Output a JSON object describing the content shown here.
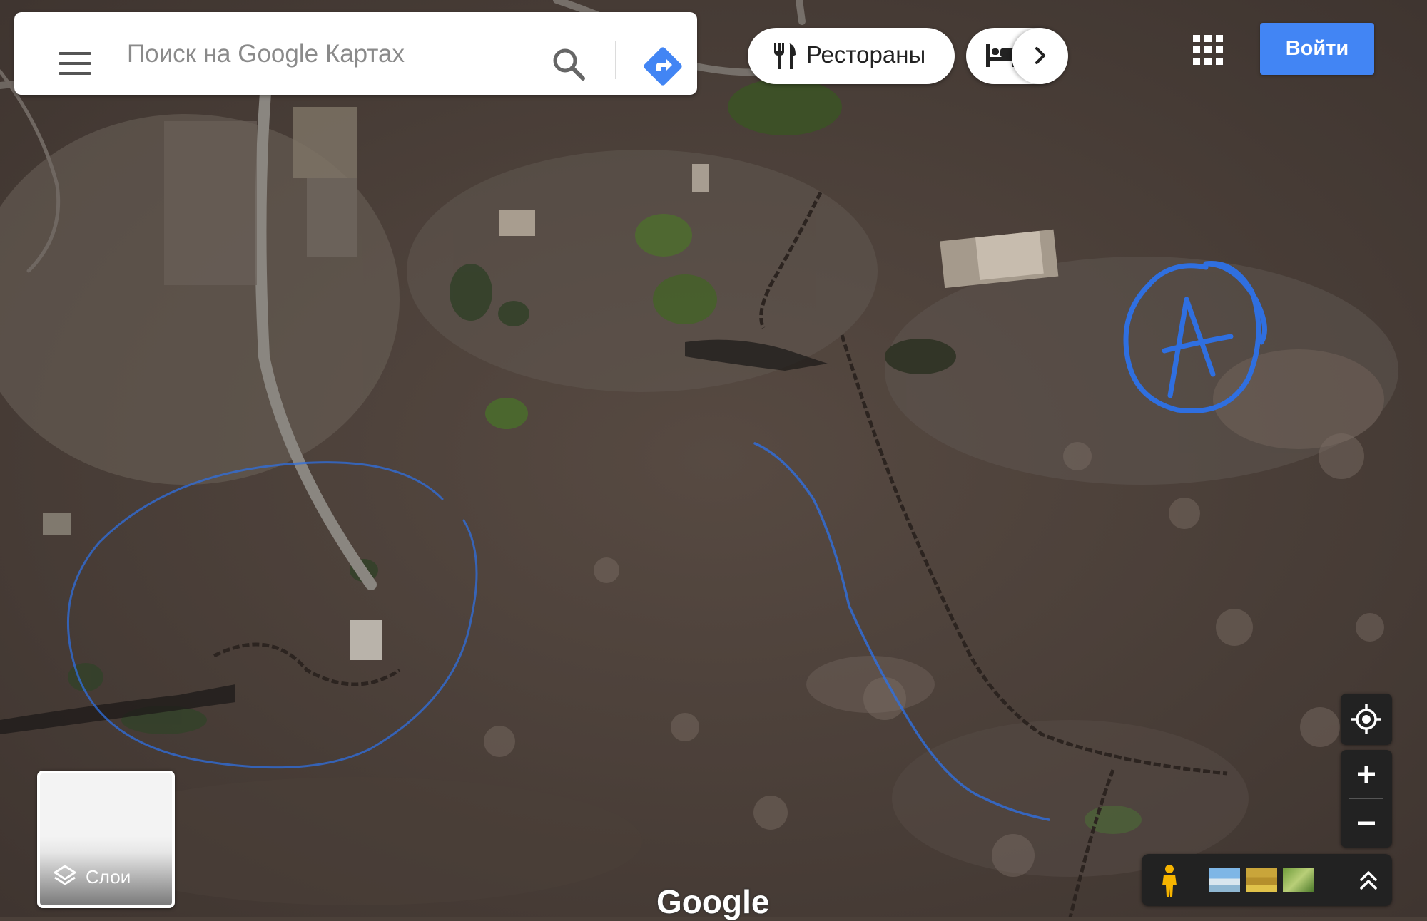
{
  "search": {
    "placeholder": "Поиск на Google Картах"
  },
  "chips": {
    "restaurants": "Рестораны",
    "hotels_icon": "bed-icon",
    "next_icon": "chevron-right-icon"
  },
  "header": {
    "apps_icon": "apps-grid-icon",
    "signin_label": "Войти",
    "signin_color": "#4285f4"
  },
  "layers": {
    "label": "Слои",
    "icon": "layers-icon"
  },
  "controls": {
    "my_location_icon": "my-location-icon",
    "zoom_in_label": "+",
    "zoom_out_label": "−",
    "pegman_icon": "pegman-icon",
    "expand_icon": "double-chevron-up-icon"
  },
  "logo": "Google",
  "annotations": {
    "marker_letter": "A",
    "ink_color": "#2f6fe0"
  }
}
